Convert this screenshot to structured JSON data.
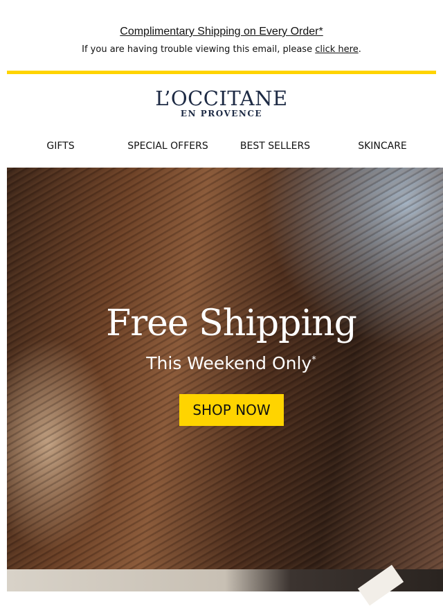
{
  "header": {
    "banner_link": "Complimentary Shipping on Every Order*",
    "trouble_text": "If you are having trouble viewing this email, please ",
    "trouble_link": "click here",
    "trouble_suffix": "."
  },
  "brand": {
    "logo_main": "L’OCCITANE",
    "logo_sub": "EN PROVENCE",
    "accent_color": "#ffd400",
    "logo_color": "#1d2a44"
  },
  "nav": {
    "items": [
      {
        "label": "GIFTS"
      },
      {
        "label": "SPECIAL OFFERS"
      },
      {
        "label": "BEST SELLERS"
      },
      {
        "label": "SKINCARE"
      }
    ]
  },
  "hero": {
    "title": "Free Shipping",
    "subtitle": "This Weekend Only",
    "subtitle_mark": "*",
    "cta": "SHOP NOW"
  }
}
